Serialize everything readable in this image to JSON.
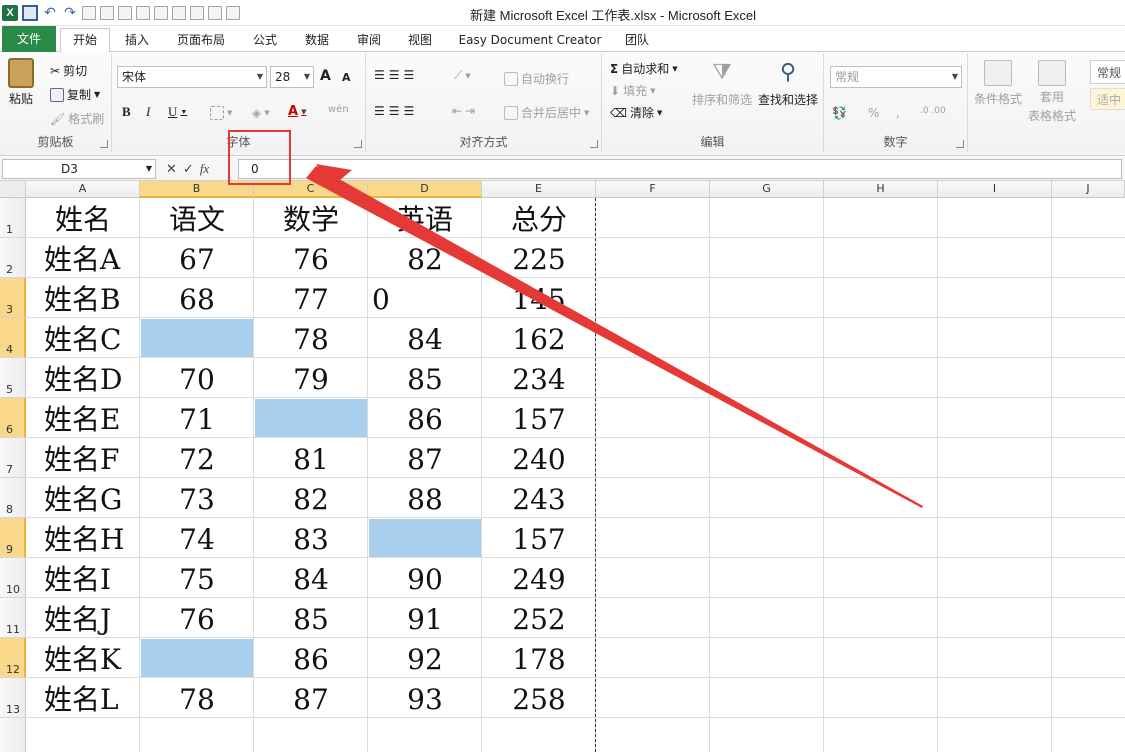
{
  "window": {
    "title": "新建 Microsoft Excel 工作表.xlsx  -  Microsoft Excel",
    "app_logo": "X"
  },
  "tabs": [
    {
      "label": "文件",
      "kind": "file"
    },
    {
      "label": "开始",
      "kind": "active"
    },
    {
      "label": "插入"
    },
    {
      "label": "页面布局"
    },
    {
      "label": "公式"
    },
    {
      "label": "数据"
    },
    {
      "label": "审阅"
    },
    {
      "label": "视图"
    },
    {
      "label": "Easy Document Creator"
    },
    {
      "label": "团队"
    }
  ],
  "ribbon": {
    "clipboard": {
      "paste": "粘贴",
      "cut": "剪切",
      "copy": "复制",
      "format_painter": "格式刷",
      "label": "剪贴板"
    },
    "font": {
      "font_name": "宋体",
      "font_size": "28",
      "bold": "B",
      "italic": "I",
      "underline": "U",
      "grow": "A",
      "shrink": "A",
      "font_color": "A",
      "phonetic": "wén",
      "label": "字体"
    },
    "alignment": {
      "wrap_text": "自动换行",
      "merge_center": "合并后居中",
      "label": "对齐方式"
    },
    "editing": {
      "autosum": "自动求和",
      "fill": "填充",
      "clear": "清除",
      "sort_filter": "排序和筛选",
      "find_select": "查找和选择",
      "label": "编辑"
    },
    "number": {
      "format": "常规",
      "percent": "%",
      "comma": ",",
      "label": "数字"
    },
    "styles": {
      "conditional": "条件格式",
      "table_format_1": "套用",
      "table_format_2": "表格格式",
      "style_normal": "常规",
      "style_medium": "适中"
    }
  },
  "formula_bar": {
    "name_box": "D3",
    "cancel": "✕",
    "enter": "✓",
    "fx": "fx",
    "content": "0"
  },
  "columns": [
    "A",
    "B",
    "C",
    "D",
    "E",
    "F",
    "G",
    "H",
    "I",
    "J"
  ],
  "rows": [
    "1",
    "2",
    "3",
    "4",
    "5",
    "6",
    "7",
    "8",
    "9",
    "10",
    "11",
    "12",
    "13"
  ],
  "selected_rows": [
    "3",
    "4",
    "6",
    "9",
    "12"
  ],
  "sheet": {
    "header": [
      "姓名",
      "语文",
      "数学",
      "英语",
      "总分"
    ],
    "data": [
      [
        "姓名A",
        "67",
        "76",
        "82",
        "225"
      ],
      [
        "姓名B",
        "68",
        "77",
        "0",
        "145"
      ],
      [
        "姓名C",
        "",
        "78",
        "84",
        "162"
      ],
      [
        "姓名D",
        "70",
        "79",
        "85",
        "234"
      ],
      [
        "姓名E",
        "71",
        "",
        "86",
        "157"
      ],
      [
        "姓名F",
        "72",
        "81",
        "87",
        "240"
      ],
      [
        "姓名G",
        "73",
        "82",
        "88",
        "243"
      ],
      [
        "姓名H",
        "74",
        "83",
        "",
        "157"
      ],
      [
        "姓名I",
        "75",
        "84",
        "90",
        "249"
      ],
      [
        "姓名J",
        "76",
        "85",
        "91",
        "252"
      ],
      [
        "姓名K",
        "",
        "86",
        "92",
        "178"
      ],
      [
        "姓名L",
        "78",
        "87",
        "93",
        "258"
      ]
    ]
  },
  "colors": {
    "file_tab": "#2a8a47",
    "blank_fill": "#a9cfee",
    "selected_header": "#f9d88b",
    "annotation_red": "#e53935"
  }
}
